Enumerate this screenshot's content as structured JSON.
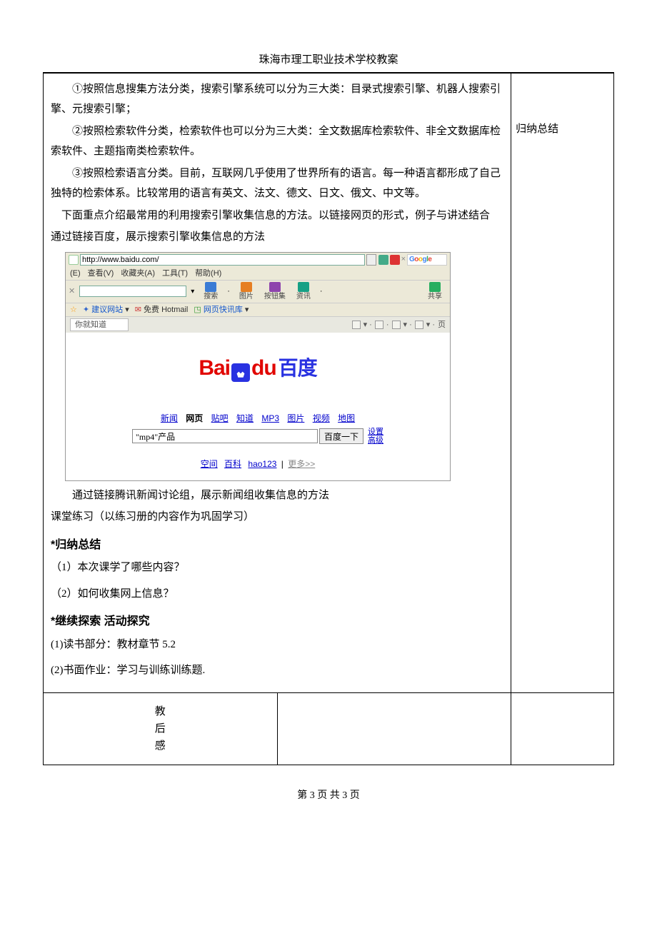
{
  "header": {
    "school": "珠海市理工职业技术学校教案"
  },
  "note": {
    "summary_label": "归纳总结"
  },
  "content": {
    "p1": "①按照信息搜集方法分类，搜索引擎系统可以分为三大类：目录式搜索引擎、机器人搜索引擎、元搜索引擎；",
    "p2": "②按照检索软件分类，检索软件也可以分为三大类：全文数据库检索软件、非全文数据库检索软件、主题指南类检索软件。",
    "p3": "③按照检索语言分类。目前，互联网几乎使用了世界所有的语言。每一种语言都形成了自己独特的检索体系。比较常用的语言有英文、法文、德文、日文、俄文、中文等。",
    "p4": "下面重点介绍最常用的利用搜索引擎收集信息的方法。以链接网页的形式，例子与讲述结合",
    "p5": "通过链接百度，展示搜索引擎收集信息的方法",
    "p6": "通过链接腾讯新闻讨论组，展示新闻组收集信息的方法",
    "p7": "课堂练习（以练习册的内容作为巩固学习）",
    "h1": "*归纳总结",
    "q1": "（1）本次课学了哪些内容？",
    "q2": "（2）如何收集网上信息？",
    "h2": "*继续探索  活动探究",
    "a1": "(1)读书部分：教材章节 5.2",
    "a2": "(2)书面作业：学习与训练训练题."
  },
  "left_label": {
    "l1": "教",
    "l2": "后",
    "l3": "感"
  },
  "browser": {
    "url": "http://www.baidu.com/",
    "google": "Google",
    "menus": {
      "file": "(E)",
      "view": "查看(V)",
      "fav": "收藏夹(A)",
      "tool": "工具(T)",
      "help": "帮助(H)"
    },
    "tool_labels": {
      "search": "搜索",
      "pic": "图片",
      "btn": "按钮集",
      "news": "资讯",
      "share": "共享"
    },
    "search_btn": "搜索",
    "link_bar": {
      "suggest": "建议网站",
      "hotmail": "免费 Hotmail",
      "slice": "网页快讯库"
    },
    "tab": "你就知道",
    "right_label": "页",
    "baidu": {
      "bai": "Bai",
      "du": "du",
      "cn": "百度"
    },
    "nav": [
      "新闻",
      "网页",
      "贴吧",
      "知道",
      "MP3",
      "图片",
      "视频",
      "地图"
    ],
    "nav_active_index": 1,
    "query": "\"mp4\"产品",
    "go": "百度一下",
    "side": {
      "set": "设置",
      "adv": "高级"
    },
    "bottom": {
      "kongjian": "空间",
      "baike": "百科",
      "hao": "hao123",
      "more": "更多>>"
    }
  },
  "footer": {
    "page": "第 3 页 共 3 页"
  }
}
